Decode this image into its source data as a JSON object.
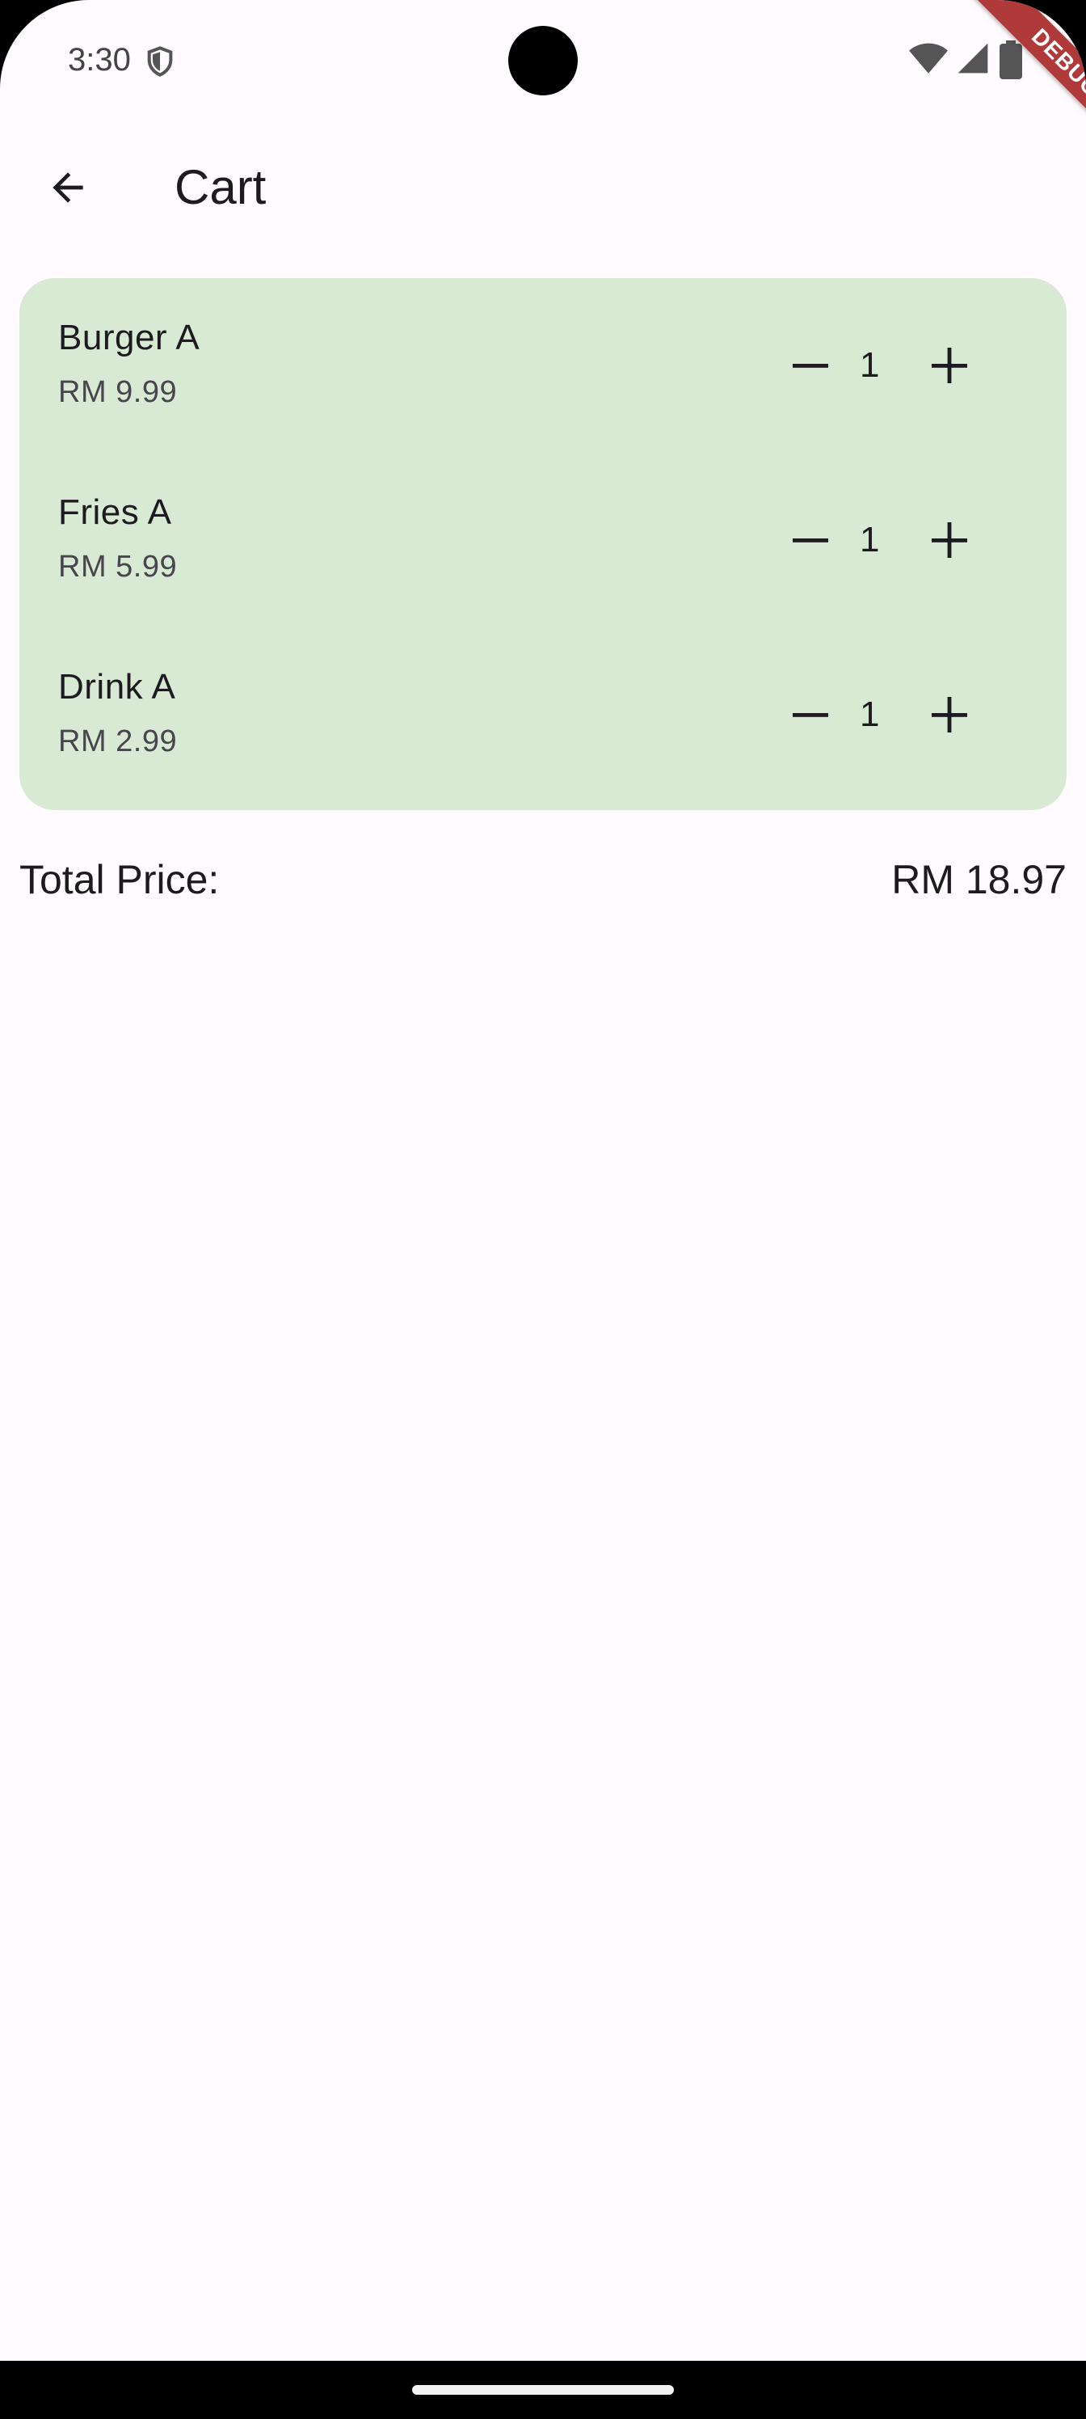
{
  "status_bar": {
    "time": "3:30",
    "icons": [
      "shield-icon",
      "wifi-icon",
      "signal-icon",
      "battery-icon"
    ]
  },
  "debug_banner": {
    "label": "DEBUG",
    "color": "#b03a3a"
  },
  "app_bar": {
    "back_icon": "arrow-back-icon",
    "title": "Cart"
  },
  "cart": {
    "background_color": "#d8ead4",
    "items": [
      {
        "name": "Burger A",
        "price": "RM 9.99",
        "quantity": "1"
      },
      {
        "name": "Fries A",
        "price": "RM 5.99",
        "quantity": "1"
      },
      {
        "name": "Drink A",
        "price": "RM 2.99",
        "quantity": "1"
      }
    ]
  },
  "total": {
    "label": "Total Price:",
    "value": "RM 18.97"
  }
}
